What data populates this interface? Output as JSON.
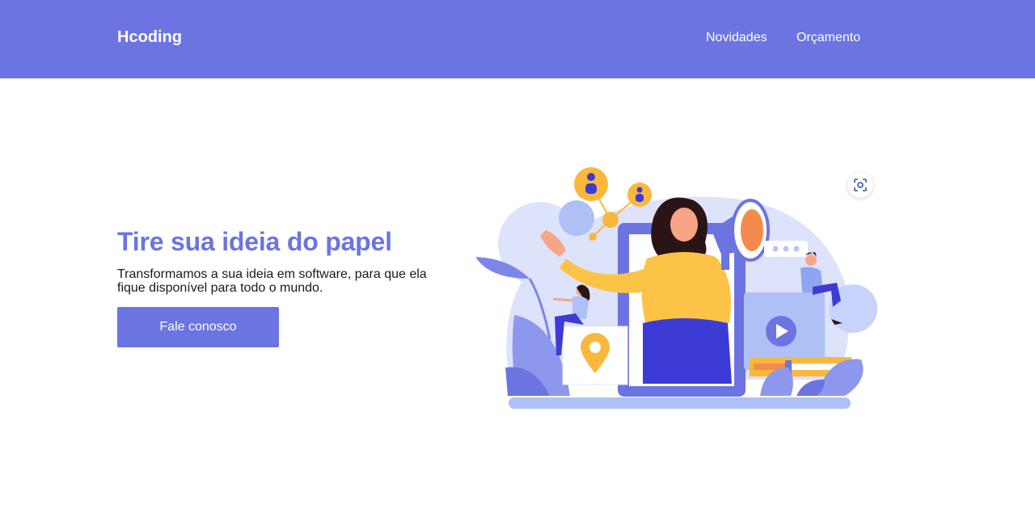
{
  "header": {
    "logo": "Hcoding",
    "nav": [
      {
        "label": "Novidades"
      },
      {
        "label": "Orçamento"
      }
    ]
  },
  "hero": {
    "title": "Tire sua ideia do papel",
    "text": "Transformamos a sua ideia em software, para que ela fique disponível para todo o mundo.",
    "cta_label": "Fale conosco"
  },
  "colors": {
    "brand": "#6b74e1",
    "accent": "#f9b83d",
    "dark_blue": "#3d3bd6"
  },
  "illustration": {
    "name": "marketing-illustration",
    "video_progress": 0.35
  }
}
